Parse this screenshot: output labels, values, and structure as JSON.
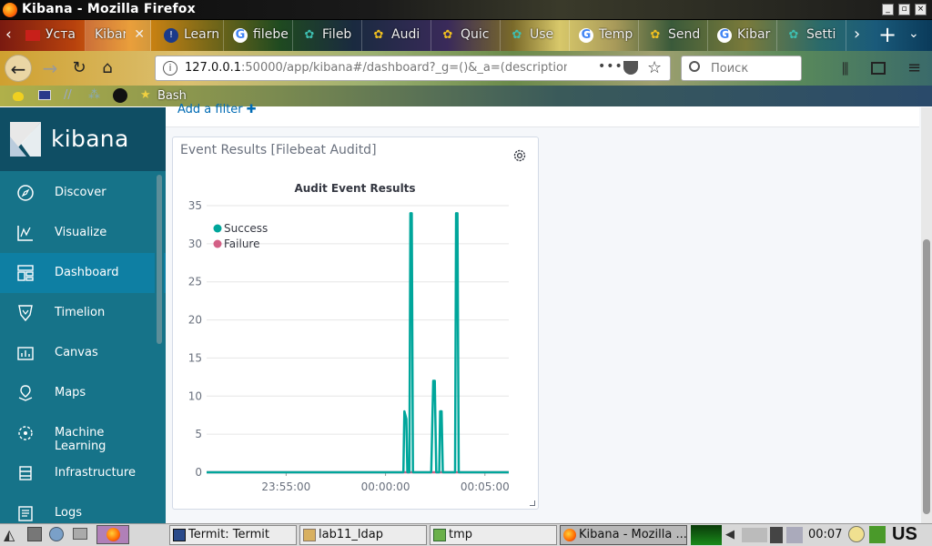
{
  "window": {
    "title": "Kibana - Mozilla Firefox"
  },
  "tabs": [
    {
      "label": "Уста",
      "icon": "red-monitor-icon"
    },
    {
      "label": "Kibar",
      "icon": "kibana-icon",
      "active": true
    },
    {
      "label": "Learn",
      "icon": "blue-circle-icon"
    },
    {
      "label": "filebe",
      "icon": "google-icon"
    },
    {
      "label": "Fileb",
      "icon": "elastic-icon"
    },
    {
      "label": "Audi",
      "icon": "elastic-icon"
    },
    {
      "label": "Quic",
      "icon": "elastic-icon"
    },
    {
      "label": "Use",
      "icon": "elastic-icon"
    },
    {
      "label": "Temp",
      "icon": "google-icon"
    },
    {
      "label": "Send",
      "icon": "elastic-icon"
    },
    {
      "label": "Kibar",
      "icon": "google-icon"
    },
    {
      "label": "Setti",
      "icon": "elastic-icon"
    }
  ],
  "nav": {
    "url_host": "127.0.0.1",
    "url_rest": ":50000/app/kibana#/dashboard?_g=()&_a=(description",
    "search_placeholder": "Поиск",
    "more": "•••"
  },
  "bookmarks": {
    "bash_label": "Bash"
  },
  "kibana": {
    "brand": "kibana",
    "add_filter": "Add a filter",
    "nav_items": [
      {
        "label": "Discover",
        "icon": "compass-icon"
      },
      {
        "label": "Visualize",
        "icon": "chart-icon"
      },
      {
        "label": "Dashboard",
        "icon": "dashboard-icon",
        "active": true
      },
      {
        "label": "Timelion",
        "icon": "timelion-icon"
      },
      {
        "label": "Canvas",
        "icon": "canvas-icon"
      },
      {
        "label": "Maps",
        "icon": "map-icon"
      },
      {
        "label": "Machine Learning",
        "icon": "ml-icon"
      },
      {
        "label": "Infrastructure",
        "icon": "infrastructure-icon"
      },
      {
        "label": "Logs",
        "icon": "logs-icon"
      }
    ],
    "panel_title": "Event Results [Filebeat Auditd]"
  },
  "chart_data": {
    "type": "line",
    "title": "Audit Event Results",
    "xlabel": "",
    "ylabel": "",
    "ylim": [
      0,
      35
    ],
    "yticks": [
      0,
      5,
      10,
      15,
      20,
      25,
      30,
      35
    ],
    "xticks": [
      "23:55:00",
      "00:00:00",
      "00:05:00"
    ],
    "xtick_minutes": [
      -5,
      0,
      5
    ],
    "xrange_minutes": [
      -9,
      6.2
    ],
    "grid": true,
    "legend_position": "top-left",
    "series": [
      {
        "name": "Success",
        "color": "#00a69b",
        "points": [
          [
            -9,
            0
          ],
          [
            0.9,
            0
          ],
          [
            0.95,
            8
          ],
          [
            1.05,
            7
          ],
          [
            1.1,
            0
          ],
          [
            1.2,
            0
          ],
          [
            1.25,
            34
          ],
          [
            1.32,
            34
          ],
          [
            1.38,
            0
          ],
          [
            2.3,
            0
          ],
          [
            2.4,
            12
          ],
          [
            2.48,
            12
          ],
          [
            2.55,
            0
          ],
          [
            2.7,
            0
          ],
          [
            2.75,
            8
          ],
          [
            2.82,
            8
          ],
          [
            2.88,
            0
          ],
          [
            3.5,
            0
          ],
          [
            3.55,
            34
          ],
          [
            3.62,
            34
          ],
          [
            3.68,
            0
          ],
          [
            6.2,
            0
          ]
        ]
      },
      {
        "name": "Failure",
        "color": "#d36086",
        "points": [
          [
            -9,
            0
          ],
          [
            6.2,
            0
          ]
        ]
      }
    ]
  },
  "taskbar": {
    "tasks": [
      {
        "label": "Termit: Termit",
        "icon": "terminal-icon"
      },
      {
        "label": "lab11_ldap",
        "icon": "folder-icon"
      },
      {
        "label": "tmp",
        "icon": "editor-icon"
      },
      {
        "label": "Kibana - Mozilla ...",
        "icon": "firefox-icon",
        "active": true
      }
    ],
    "clock": "00:07",
    "layout": "US"
  }
}
